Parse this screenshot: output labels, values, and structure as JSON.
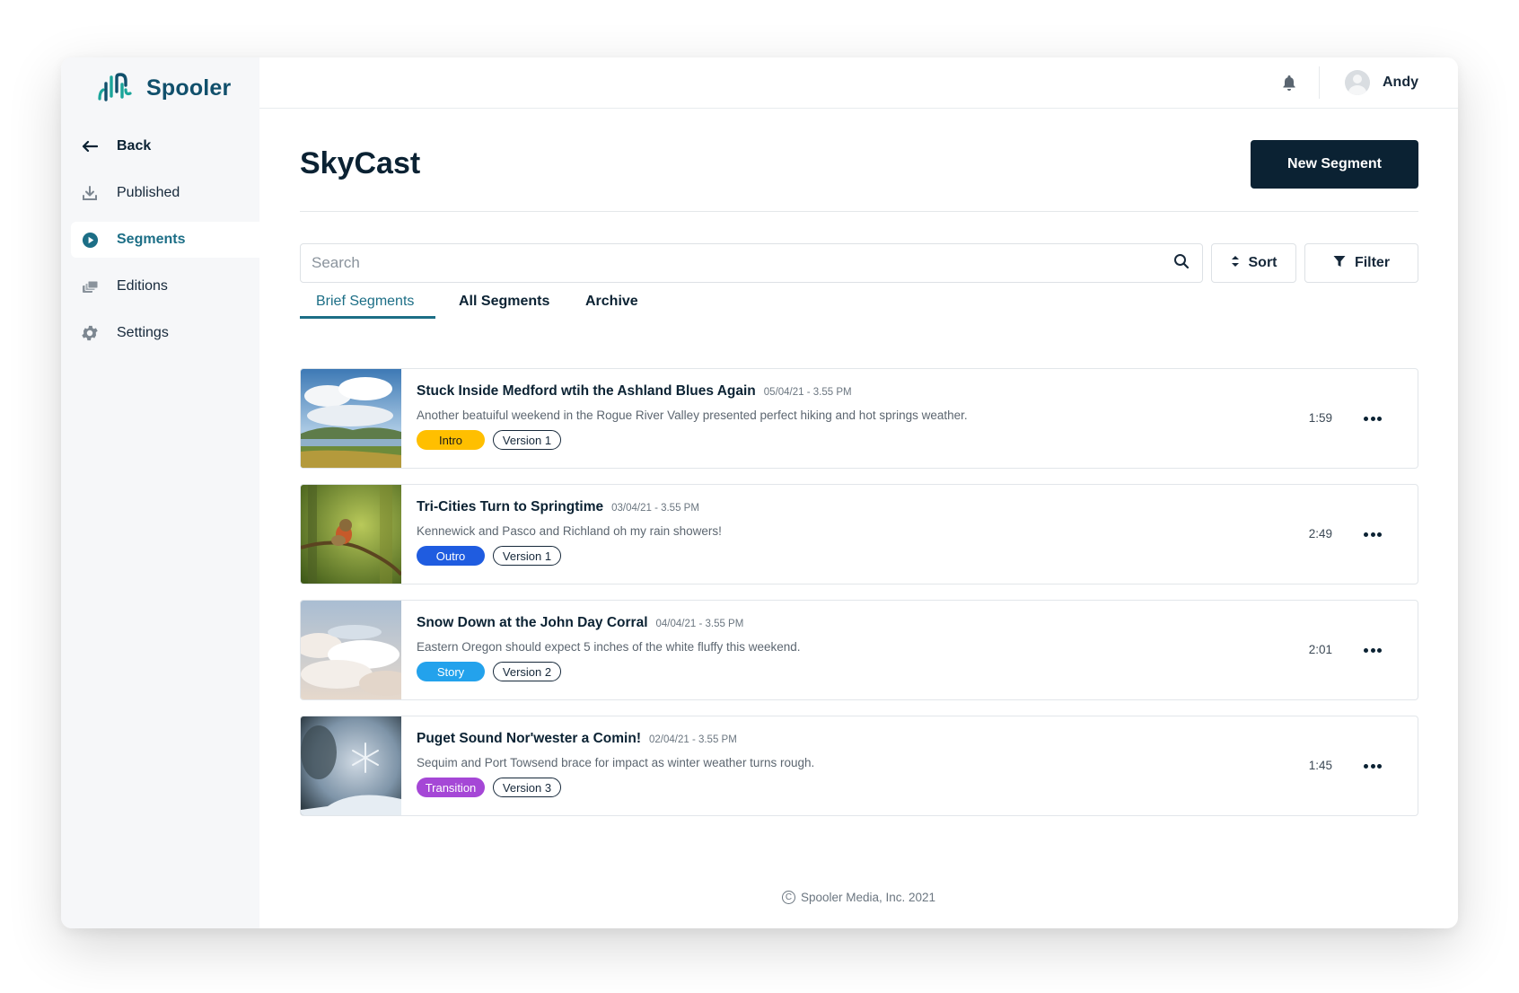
{
  "app": {
    "name": "Spooler"
  },
  "sidebar": {
    "items": [
      {
        "label": "Back",
        "icon": "arrow-left-icon"
      },
      {
        "label": "Published",
        "icon": "download-icon"
      },
      {
        "label": "Segments",
        "icon": "play-circle-icon",
        "active": true
      },
      {
        "label": "Editions",
        "icon": "stack-icon"
      },
      {
        "label": "Settings",
        "icon": "gear-icon"
      }
    ]
  },
  "topbar": {
    "user_name": "Andy"
  },
  "page": {
    "title": "SkyCast",
    "new_button": "New Segment"
  },
  "search": {
    "placeholder": "Search",
    "value": ""
  },
  "controls": {
    "sort_label": "Sort",
    "filter_label": "Filter"
  },
  "tabs": [
    {
      "label": "Brief Segments",
      "active": true
    },
    {
      "label": "All Segments"
    },
    {
      "label": "Archive"
    }
  ],
  "segments": [
    {
      "title": "Stuck Inside Medford wtih the Ashland Blues Again",
      "date": "05/04/21 - 3.55 PM",
      "description": "Another beatuiful weekend in the Rogue River Valley presented perfect hiking and hot springs weather.",
      "type": "Intro",
      "version": "Version 1",
      "duration": "1:59"
    },
    {
      "title": "Tri-Cities Turn to Springtime",
      "date": "03/04/21 - 3.55 PM",
      "description": "Kennewick and Pasco and Richland oh my rain showers!",
      "type": "Outro",
      "version": "Version 1",
      "duration": "2:49"
    },
    {
      "title": "Snow Down at the John Day Corral",
      "date": "04/04/21 - 3.55 PM",
      "description": "Eastern Oregon should expect 5 inches of the white fluffy this weekend.",
      "type": "Story",
      "version": "Version 2",
      "duration": "2:01"
    },
    {
      "title": "Puget Sound Nor'wester a Comin!",
      "date": "02/04/21 - 3.55 PM",
      "description": "Sequim and Port Towsend brace for impact as winter weather turns rough.",
      "type": "Transition",
      "version": "Version 3",
      "duration": "1:45"
    }
  ],
  "footer": {
    "copyright_symbol": "C",
    "text": "Spooler Media, Inc. 2021"
  },
  "colors": {
    "brand": "#11506c",
    "accent": "#1c6e86",
    "primary_button": "#0b2233",
    "tag_intro": "#ffbf00",
    "tag_outro": "#1f5ce0",
    "tag_story": "#23a2ec",
    "tag_transition": "#a547d6"
  }
}
